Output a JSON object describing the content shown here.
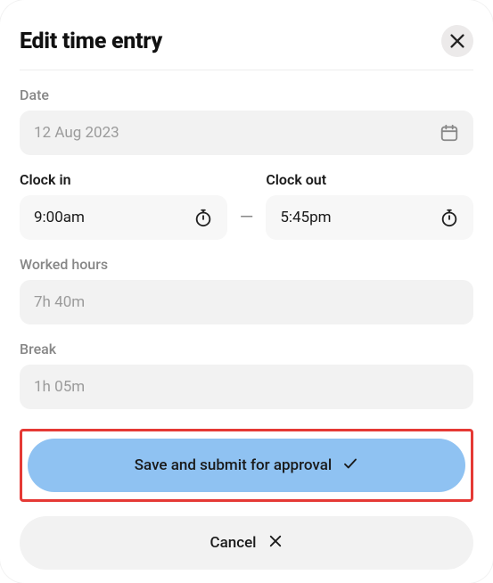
{
  "header": {
    "title": "Edit time entry"
  },
  "fields": {
    "date": {
      "label": "Date",
      "value": "12 Aug 2023"
    },
    "clockIn": {
      "label": "Clock in",
      "value": "9:00am"
    },
    "clockOut": {
      "label": "Clock out",
      "value": "5:45pm"
    },
    "workedHours": {
      "label": "Worked hours",
      "value": "7h 40m"
    },
    "breakTime": {
      "label": "Break",
      "value": "1h 05m"
    }
  },
  "separator": "—",
  "buttons": {
    "save": "Save and submit for approval",
    "cancel": "Cancel"
  }
}
